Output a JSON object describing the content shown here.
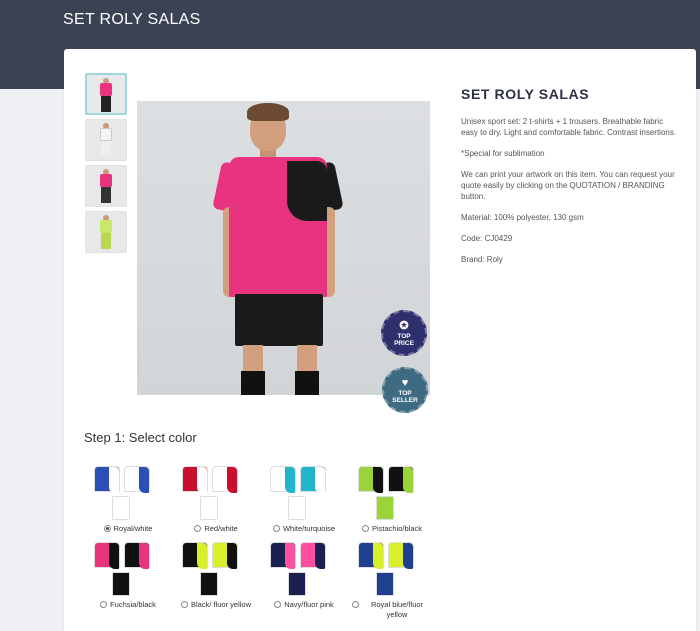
{
  "header": {
    "title": "SET ROLY SALAS"
  },
  "thumbnails": [
    {
      "color": "#e8337f",
      "active": true
    },
    {
      "color": "#f2f2f2",
      "active": false
    },
    {
      "color": "#e8337f",
      "active": false
    },
    {
      "color": "#c9e86a",
      "active": false
    }
  ],
  "product": {
    "title": "SET ROLY SALAS",
    "description": "Unisex sport set: 2 t-shirts + 1 trousers. Breathable fabric easy to dry. Light and comfortable fabric. Contrast insertions.",
    "special": "*Special for sublimation",
    "branding_note": "We can print your artwork on this item. You can request your quote easily by clicking on the QUOTATION / BRANDING button.",
    "material": "Material: 100% polyester, 130 gsm",
    "code": "Code: CJ0429",
    "brand": "Brand: Roly"
  },
  "badges": {
    "top_price_line1": "TOP",
    "top_price_line2": "PRICE",
    "top_seller_line1": "TOP",
    "top_seller_line2": "SELLER"
  },
  "step1": {
    "title": "Step 1: Select color",
    "options": [
      {
        "label": "Royal/white",
        "checked": true,
        "tee1": "#2b4fb5",
        "tee1_panel": "#ffffff",
        "tee2": "#ffffff",
        "tee2_panel": "#2b4fb5",
        "shorts": "#ffffff"
      },
      {
        "label": "Red/white",
        "checked": false,
        "tee1": "#c8102e",
        "tee1_panel": "#ffffff",
        "tee2": "#ffffff",
        "tee2_panel": "#c8102e",
        "shorts": "#ffffff"
      },
      {
        "label": "White/turquoise",
        "checked": false,
        "tee1": "#ffffff",
        "tee1_panel": "#23b5c9",
        "tee2": "#23b5c9",
        "tee2_panel": "#ffffff",
        "shorts": "#ffffff"
      },
      {
        "label": "Pistachio/black",
        "checked": false,
        "tee1": "#9bd33a",
        "tee1_panel": "#111111",
        "tee2": "#111111",
        "tee2_panel": "#9bd33a",
        "shorts": "#9bd33a"
      },
      {
        "label": "Fuchsia/black",
        "checked": false,
        "tee1": "#e8337f",
        "tee1_panel": "#111111",
        "tee2": "#111111",
        "tee2_panel": "#e8337f",
        "shorts": "#111111"
      },
      {
        "label": "Black/ fluor yellow",
        "checked": false,
        "tee1": "#111111",
        "tee1_panel": "#d9ef2a",
        "tee2": "#d9ef2a",
        "tee2_panel": "#111111",
        "shorts": "#111111"
      },
      {
        "label": "Navy/fluor pink",
        "checked": false,
        "tee1": "#1a2150",
        "tee1_panel": "#ff4fa0",
        "tee2": "#ff4fa0",
        "tee2_panel": "#1a2150",
        "shorts": "#1a2150"
      },
      {
        "label": "Royal blue/fluor yellow",
        "checked": false,
        "tee1": "#1f3f8f",
        "tee1_panel": "#d9ef2a",
        "tee2": "#d9ef2a",
        "tee2_panel": "#1f3f8f",
        "shorts": "#1f3f8f"
      }
    ]
  }
}
